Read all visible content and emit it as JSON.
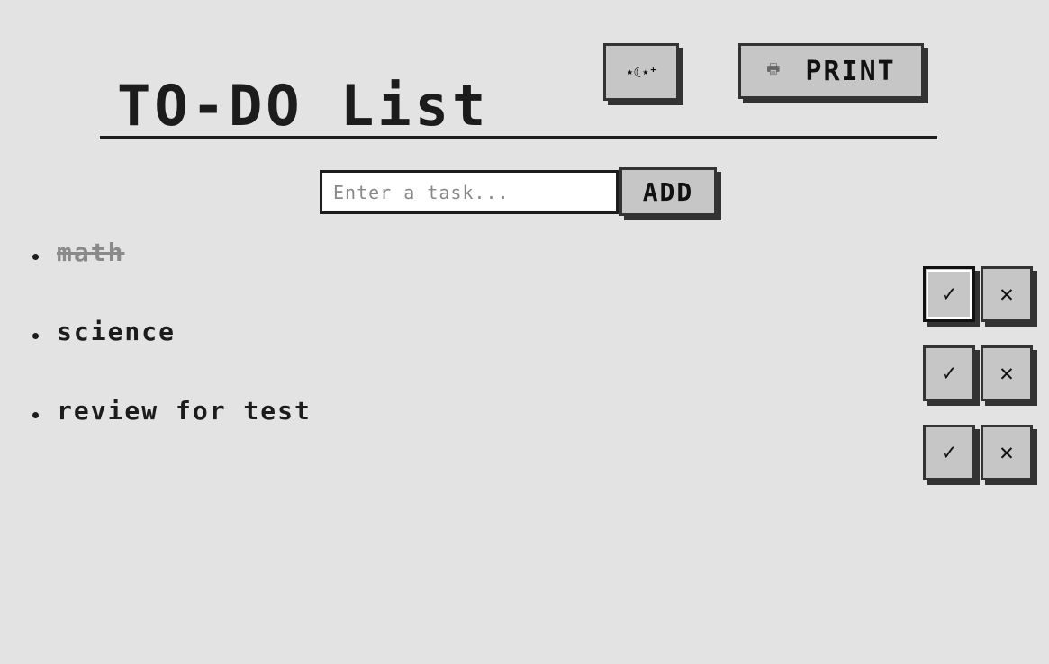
{
  "header": {
    "title": "TO-DO List",
    "theme_toggle_label": "⋆☾⋆⁺",
    "print_icon": "🖶",
    "print_label": "PRINT"
  },
  "form": {
    "placeholder": "Enter a task...",
    "value": "",
    "add_label": "ADD"
  },
  "actions": {
    "complete_symbol": "✓",
    "delete_symbol": "✕"
  },
  "tasks": [
    {
      "text": "math",
      "completed": true
    },
    {
      "text": "science",
      "completed": false
    },
    {
      "text": "review for test",
      "completed": false
    }
  ]
}
